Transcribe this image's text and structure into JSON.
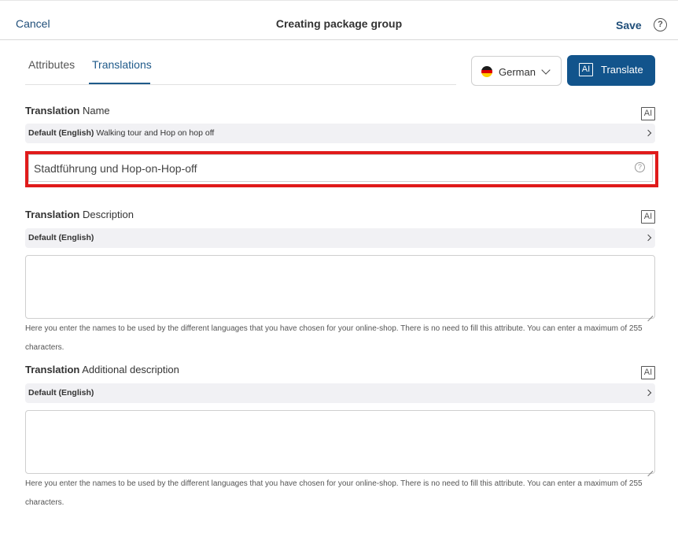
{
  "header": {
    "cancel_label": "Cancel",
    "title": "Creating package group",
    "save_label": "Save",
    "help_glyph": "?"
  },
  "tabs": [
    {
      "label": "Attributes",
      "active": false
    },
    {
      "label": "Translations",
      "active": true
    }
  ],
  "language_select": {
    "value": "German",
    "flag": "germany-flag"
  },
  "translate_button": {
    "icon": "AI",
    "label": "Translate"
  },
  "sections": {
    "name": {
      "label_bold": "Translation",
      "label_rest": " Name",
      "ai_icon": "AI",
      "default_bold": "Default (English)",
      "default_value": " Walking tour and Hop on hop off",
      "input_value": "Stadtführung und Hop-on-Hop-off",
      "input_help": "?"
    },
    "description": {
      "label_bold": "Translation",
      "label_rest": " Description",
      "ai_icon": "AI",
      "default_bold": "Default (English)",
      "default_value": "",
      "textarea_value": "",
      "hint": "Here you enter the names to be used by the different languages that you have chosen for your online-shop. There is no need to fill this attribute. You can enter a maximum of 255 characters."
    },
    "additional": {
      "label_bold": "Translation",
      "label_rest": " Additional description",
      "ai_icon": "AI",
      "default_bold": "Default (English)",
      "default_value": "",
      "textarea_value": "",
      "hint": "Here you enter the names to be used by the different languages that you have chosen for your online-shop. There is no need to fill this attribute. You can enter a maximum of 255 characters."
    }
  },
  "colors": {
    "accent": "#12548c",
    "link": "#1f4e79",
    "highlight": "#e01b1b"
  }
}
